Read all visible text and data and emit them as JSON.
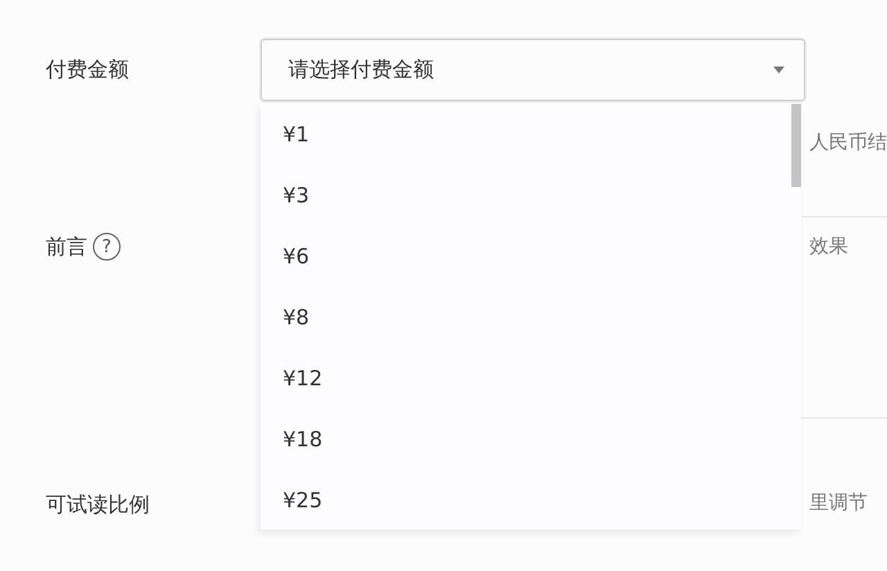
{
  "amount_field": {
    "label": "付费金额",
    "placeholder": "请选择付费金额",
    "expanded": true
  },
  "dropdown_options": [
    {
      "label": "¥1",
      "selected": false
    },
    {
      "label": "¥3",
      "selected": false
    },
    {
      "label": "¥6",
      "selected": false
    },
    {
      "label": "¥8",
      "selected": false
    },
    {
      "label": "¥12",
      "selected": false
    },
    {
      "label": "¥18",
      "selected": false
    },
    {
      "label": "¥25",
      "selected": false
    }
  ],
  "amount_note": "人民币结",
  "preface": {
    "label": "前言",
    "help_icon": "?",
    "note": "效果"
  },
  "trial_ratio": {
    "label": "可试读比例",
    "note": "里调节"
  }
}
